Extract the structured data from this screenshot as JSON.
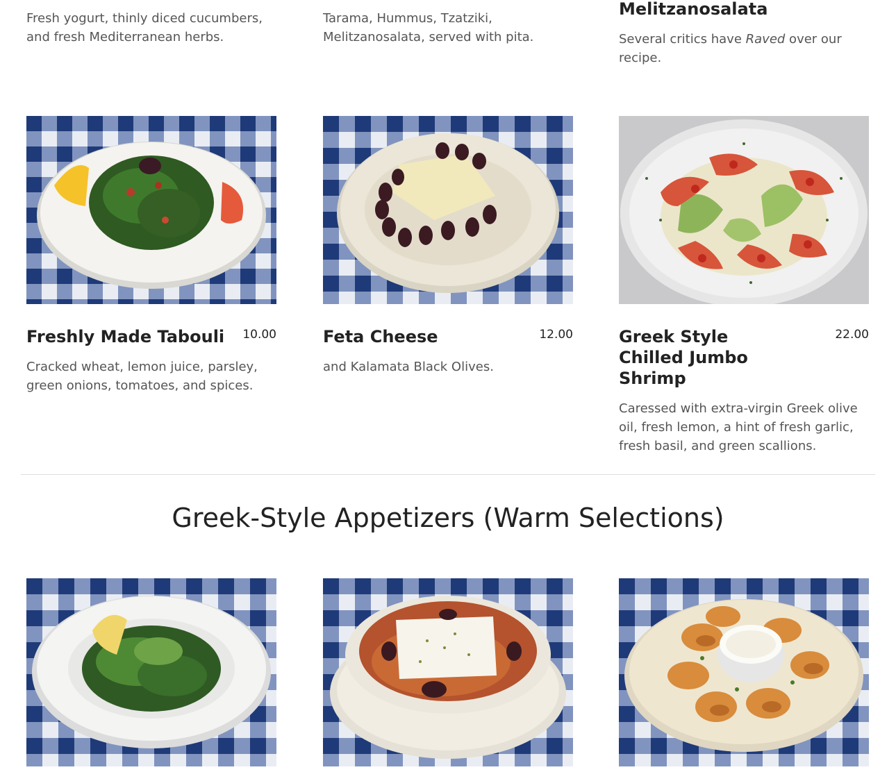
{
  "top_row": {
    "col1": {
      "description": "Fresh yogurt, thinly diced cucumbers, and fresh Mediterranean herbs."
    },
    "col2": {
      "description": "Tarama, Hummus, Tzatziki, Melitzanosalata, served with pita."
    },
    "col3": {
      "title": "Melitzanosalata",
      "description_before": "Several critics have ",
      "description_emphasis": "Raved",
      "description_after": " over our recipe."
    }
  },
  "cold_items": [
    {
      "title": "Freshly Made Tabouli",
      "price": "10.00",
      "description": "Cracked wheat, lemon juice, parsley, green onions, tomatoes, and spices.",
      "image": "tabouli-plate"
    },
    {
      "title": "Feta Cheese",
      "price": "12.00",
      "description": "and Kalamata Black Olives.",
      "image": "feta-olives-plate"
    },
    {
      "title": "Greek Style Chilled Jumbo Shrimp",
      "price": "22.00",
      "description": "Caressed with extra-virgin Greek olive oil, fresh lemon, a hint of fresh garlic, fresh basil, and green scallions.",
      "image": "chilled-shrimp-plate"
    }
  ],
  "warm_section": {
    "heading": "Greek-Style Appetizers (Warm Selections)",
    "images": [
      "greens-plate",
      "baked-feta-dish",
      "fried-appetizer-plate"
    ]
  },
  "colors": {
    "tablecloth_blue": "#1f3a78",
    "tablecloth_light": "#e9edf3",
    "plate_white": "#f4f3ef",
    "text_dark": "#222222",
    "text_muted": "#555555"
  }
}
